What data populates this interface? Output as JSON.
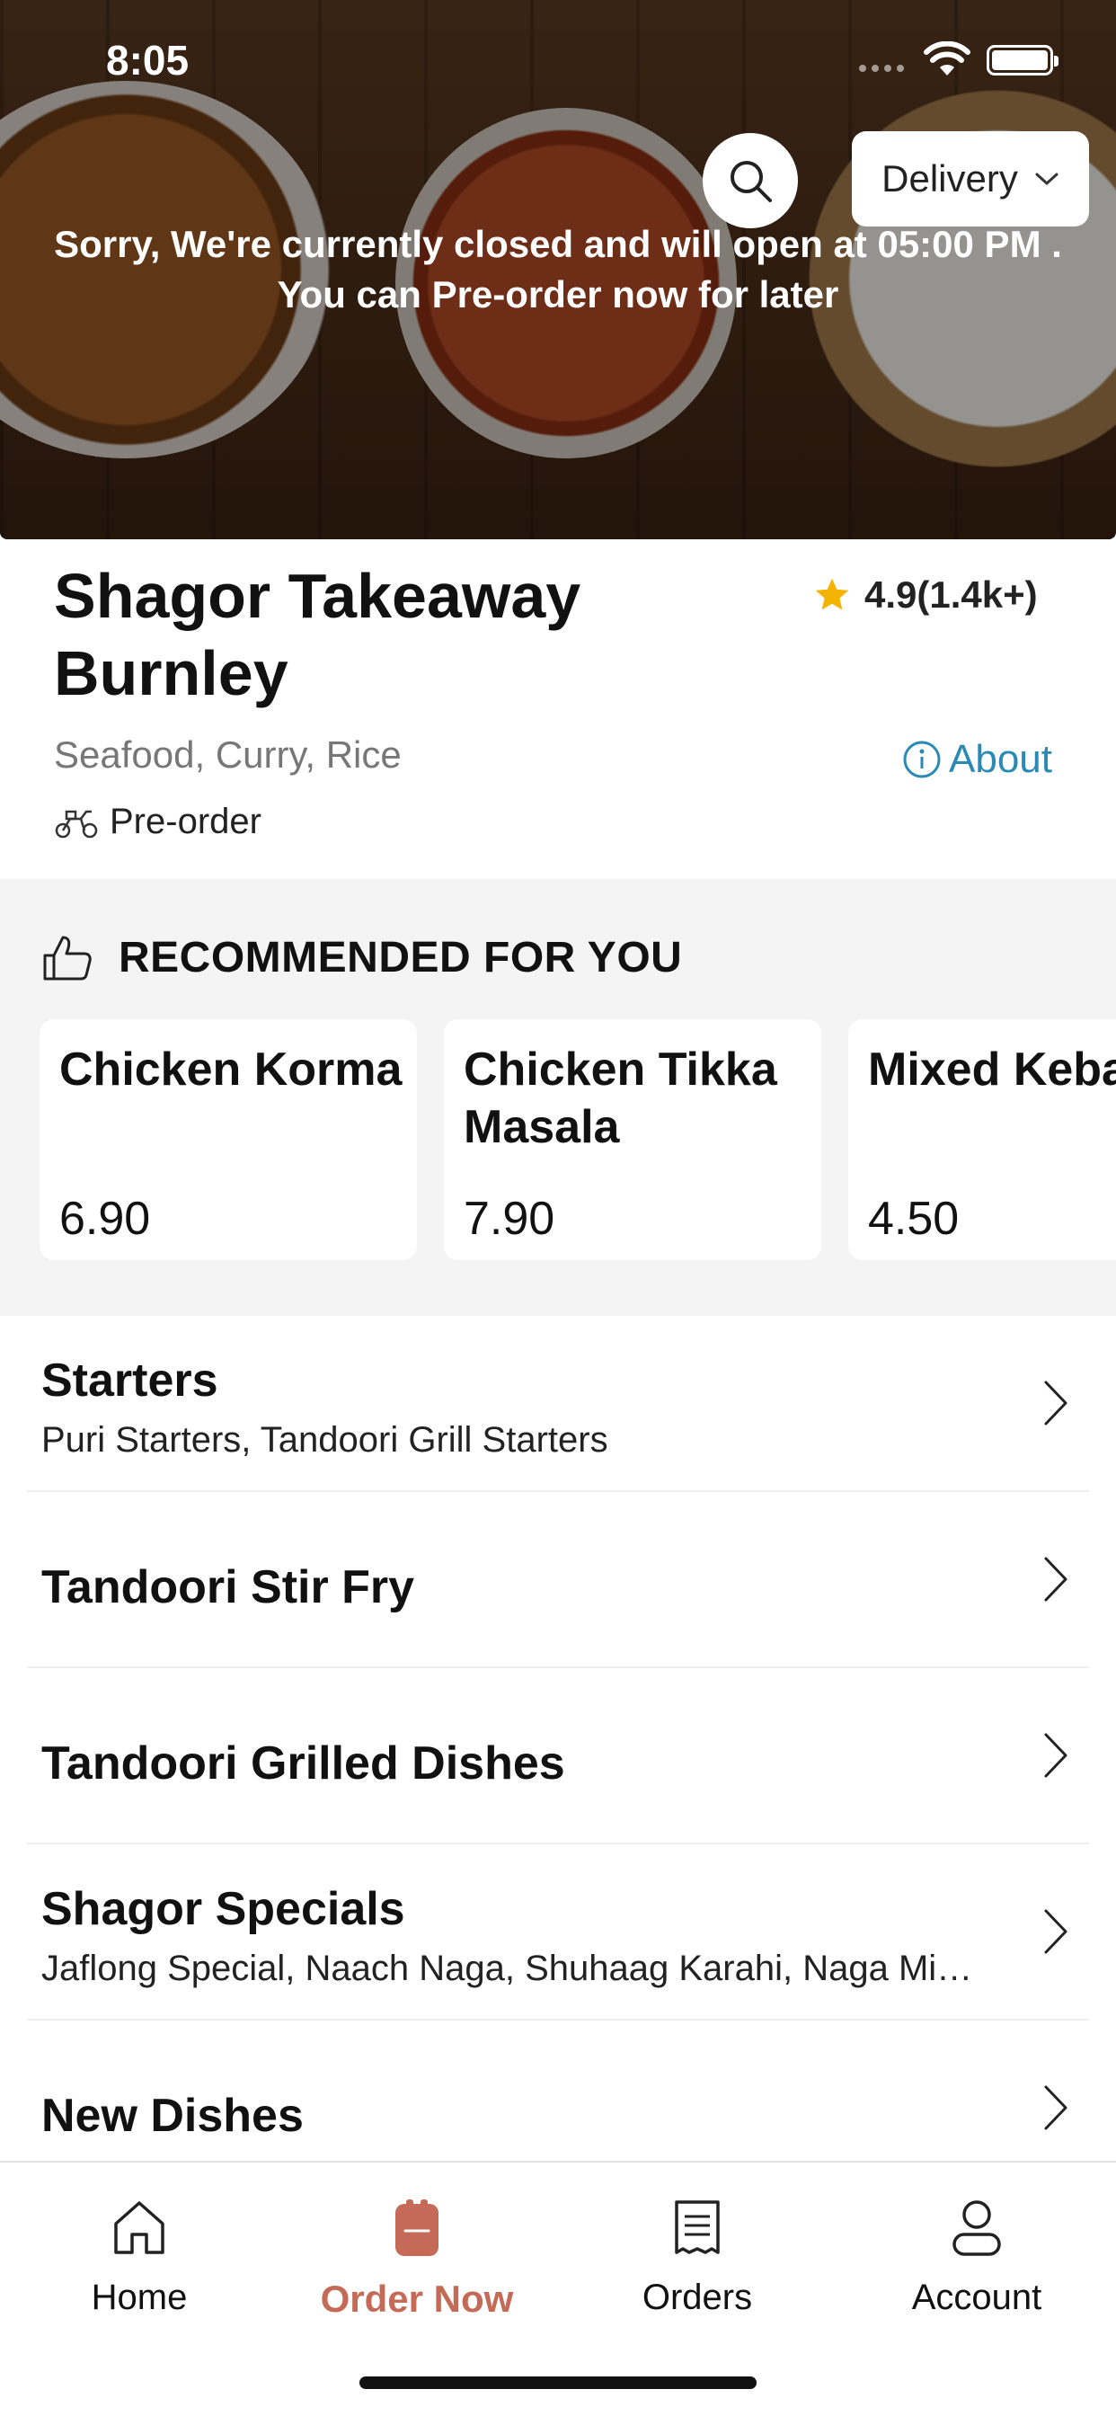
{
  "status_bar": {
    "time": "8:05"
  },
  "hero": {
    "delivery_label": "Delivery",
    "closed_message_line1": "Sorry, We're currently closed and will open at 05:00 PM .",
    "closed_message_line2": "You can Pre-order now for later"
  },
  "restaurant": {
    "name": "Shagor Takeaway Burnley",
    "rating": "4.9(1.4k+)",
    "cuisines": "Seafood, Curry, Rice",
    "about_label": "About",
    "preorder_label": "Pre-order"
  },
  "recommended": {
    "title": "RECOMMENDED FOR YOU",
    "items": [
      {
        "name": "Chicken Korma",
        "price": "6.90"
      },
      {
        "name": "Chicken Tikka Masala",
        "price": "7.90"
      },
      {
        "name": "Mixed Kebab Starter",
        "price": "4.50"
      }
    ]
  },
  "categories": [
    {
      "title": "Starters",
      "subtitle": "Puri Starters, Tandoori Grill Starters"
    },
    {
      "title": "Tandoori Stir Fry",
      "subtitle": ""
    },
    {
      "title": "Tandoori Grilled Dishes",
      "subtitle": ""
    },
    {
      "title": "Shagor Specials",
      "subtitle": "Jaflong Special, Naach Naga, Shuhaag Karahi, Naga Mi…"
    },
    {
      "title": "New Dishes",
      "subtitle": ""
    }
  ],
  "tabbar": {
    "tabs": [
      {
        "label": "Home",
        "icon": "home-icon"
      },
      {
        "label": "Order Now",
        "icon": "order-icon",
        "active": true
      },
      {
        "label": "Orders",
        "icon": "receipt-icon"
      },
      {
        "label": "Account",
        "icon": "person-icon"
      }
    ]
  },
  "colors": {
    "accent": "#c46a56",
    "link": "#2a8ab5",
    "star": "#f5b301",
    "section_bg": "#f4f4f4"
  }
}
